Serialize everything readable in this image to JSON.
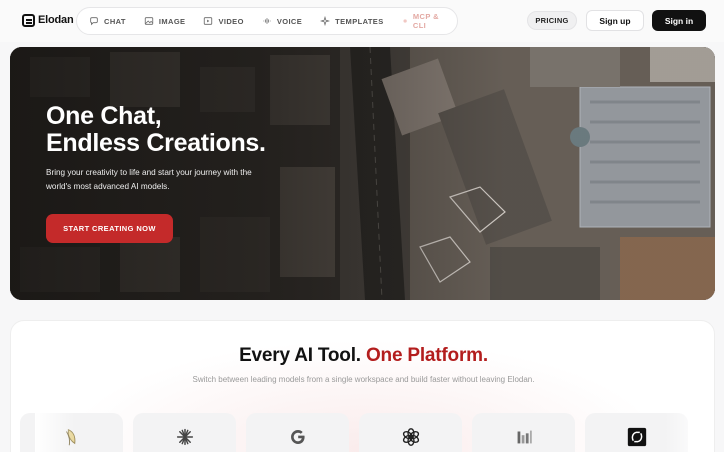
{
  "brand": {
    "name": "Elodan"
  },
  "nav": {
    "items": [
      {
        "label": "CHAT",
        "icon": "chat-bubble-icon"
      },
      {
        "label": "IMAGE",
        "icon": "image-icon"
      },
      {
        "label": "VIDEO",
        "icon": "video-play-icon"
      },
      {
        "label": "VOICE",
        "icon": "waveform-icon"
      },
      {
        "label": "TEMPLATES",
        "icon": "sparkle-icon"
      },
      {
        "label": "MCP & CLI",
        "icon": "plug-icon"
      }
    ]
  },
  "header": {
    "pricing_label": "PRICING",
    "signup_label": "Sign up",
    "signin_label": "Sign in"
  },
  "hero": {
    "title_line1": "One Chat,",
    "title_line2": "Endless Creations.",
    "subtitle": "Bring your creativity to life and start your journey with the world's most advanced AI models.",
    "cta_label": "START CREATING NOW"
  },
  "platform": {
    "title_main": "Every AI Tool.",
    "title_accent": "One Platform.",
    "subtitle": "Switch between leading models from a single workspace and build faster without leaving Elodan.",
    "tools": [
      {
        "icon": "banana-icon"
      },
      {
        "icon": "claude-asterisk-icon"
      },
      {
        "icon": "google-g-icon"
      },
      {
        "icon": "openai-knot-icon"
      },
      {
        "icon": "bars-logo-icon"
      },
      {
        "icon": "grok-logo-icon"
      }
    ]
  },
  "colors": {
    "accent": "#b31d1d",
    "cta": "#c42a2a",
    "dark_button": "#111111"
  }
}
